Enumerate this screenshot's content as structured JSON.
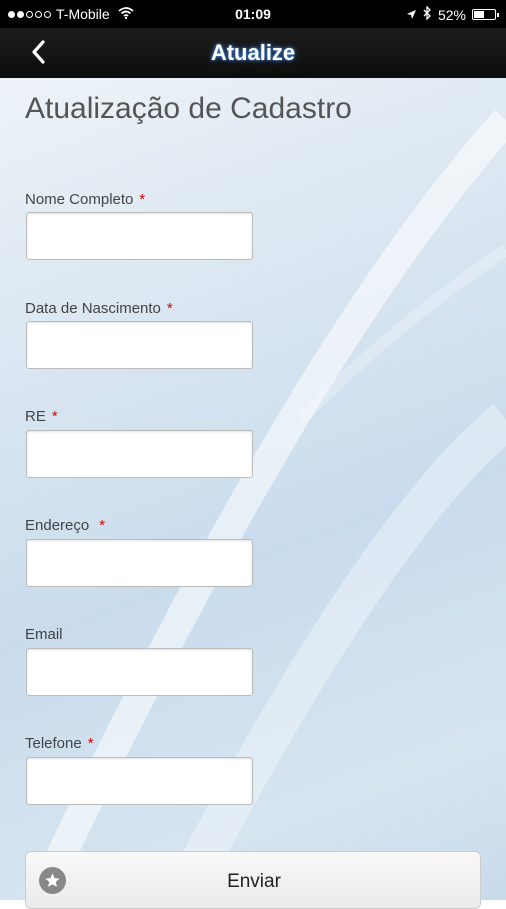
{
  "status_bar": {
    "carrier": "T-Mobile",
    "time": "01:09",
    "battery": "52%",
    "battery_level": 0.52,
    "icons": [
      "signal-dots-icon",
      "wifi-icon",
      "location-arrow-icon",
      "bluetooth-icon",
      "battery-icon"
    ]
  },
  "nav": {
    "title": "Atualize",
    "back_icon": "chevron-left-icon"
  },
  "form": {
    "title": "Atualização de Cadastro",
    "required_mark": "*",
    "fields": [
      {
        "label": "Nome Completo",
        "required": true,
        "value": ""
      },
      {
        "label": "Data de Nascimento",
        "required": true,
        "value": ""
      },
      {
        "label": "RE",
        "required": true,
        "value": ""
      },
      {
        "label": "Endereço",
        "required": true,
        "value": ""
      },
      {
        "label": "Email",
        "required": false,
        "value": ""
      },
      {
        "label": "Telefone",
        "required": true,
        "value": ""
      }
    ],
    "submit_label": "Enviar",
    "submit_icon": "star-icon"
  },
  "colors": {
    "required": "#dd0000",
    "nav_title_glow": "#3d7fd6"
  }
}
